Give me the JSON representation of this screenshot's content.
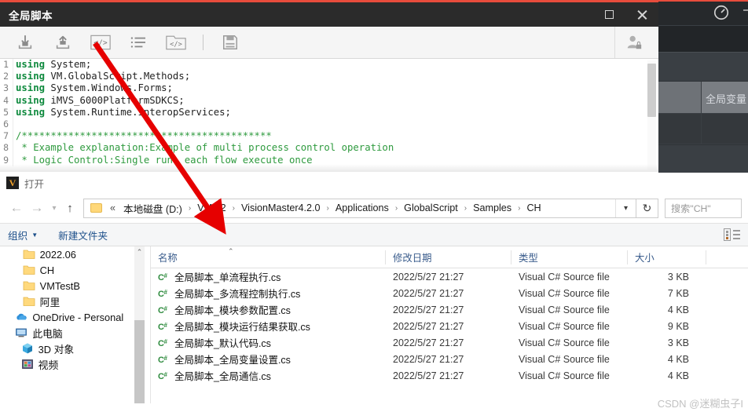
{
  "background_app": {
    "accent_color": "#e74c3c",
    "gauge_icon": "gauge-icon",
    "panel_label": "全局变量"
  },
  "script_window": {
    "title": "全局脚本",
    "window_buttons": {
      "maximize": "maximize-icon",
      "close": "close-icon"
    },
    "toolbar": {
      "items": [
        {
          "name": "import-icon",
          "label": "导入"
        },
        {
          "name": "export-icon",
          "label": "导出"
        },
        {
          "name": "code-snippet-icon",
          "label": "代码片段"
        },
        {
          "name": "list-icon",
          "label": "列表"
        },
        {
          "name": "code-folder-icon",
          "label": "代码文件夹"
        },
        {
          "name": "save-icon",
          "label": "保存"
        }
      ],
      "user_icon": "user-lock-icon"
    },
    "code": {
      "lines": [
        {
          "n": "1",
          "kw": "using",
          "rest": " System;"
        },
        {
          "n": "2",
          "kw": "using",
          "rest": " VM.GlobalScript.Methods;"
        },
        {
          "n": "3",
          "kw": "using",
          "rest": " System.Windows.Forms;"
        },
        {
          "n": "4",
          "kw": "using",
          "rest": " iMVS_6000PlatformSDKCS;"
        },
        {
          "n": "5",
          "kw": "using",
          "rest": " System.Runtime.InteropServices;"
        },
        {
          "n": "6",
          "kw": "",
          "rest": ""
        },
        {
          "n": "7",
          "cm": "/*******************************************"
        },
        {
          "n": "8",
          "cm": " * Example explanation:Example of multi process control operation"
        },
        {
          "n": "9",
          "cm": " * Logic Control:Single run, each flow execute once"
        }
      ]
    }
  },
  "explorer": {
    "caption": "打开",
    "logo_text": "V",
    "nav": {
      "back": "back-arrow-icon",
      "forward": "forward-arrow-icon",
      "recent": "recent-dropdown-icon",
      "up": "up-arrow-icon",
      "refresh": "refresh-icon",
      "address_dropdown": "address-dropdown-icon"
    },
    "breadcrumb": {
      "overflow": "«",
      "items": [
        "本地磁盘 (D:)",
        "VM4.2",
        "VisionMaster4.2.0",
        "Applications",
        "GlobalScript",
        "Samples",
        "CH"
      ],
      "separator": "›"
    },
    "search_placeholder": "搜索\"CH\"",
    "command_bar": {
      "organize": "组织",
      "new_folder": "新建文件夹",
      "view_icon": "view-layout-icon"
    },
    "tree": [
      {
        "label": "2022.06",
        "icon": "folder-icon",
        "indent": 86
      },
      {
        "label": "CH",
        "icon": "folder-icon",
        "indent": 86
      },
      {
        "label": "VMTestB",
        "icon": "folder-icon",
        "indent": 86
      },
      {
        "label": "阿里",
        "icon": "folder-icon",
        "indent": 86
      },
      {
        "label": "OneDrive - Personal",
        "icon": "onedrive-icon",
        "indent": 58
      },
      {
        "label": "此电脑",
        "icon": "this-pc-icon",
        "indent": 58
      },
      {
        "label": "3D 对象",
        "icon": "3d-objects-icon",
        "indent": 80
      },
      {
        "label": "视频",
        "icon": "videos-icon",
        "indent": 80
      }
    ],
    "file_list": {
      "columns": [
        "名称",
        "修改日期",
        "类型",
        "大小"
      ],
      "sort_indicator": "ascending",
      "rows": [
        {
          "name": "全局脚本_单流程执行.cs",
          "date": "2022/5/27 21:27",
          "type": "Visual C# Source file",
          "size": "3 KB",
          "icon": "csharp-file-icon"
        },
        {
          "name": "全局脚本_多流程控制执行.cs",
          "date": "2022/5/27 21:27",
          "type": "Visual C# Source file",
          "size": "7 KB",
          "icon": "csharp-file-icon"
        },
        {
          "name": "全局脚本_模块参数配置.cs",
          "date": "2022/5/27 21:27",
          "type": "Visual C# Source file",
          "size": "4 KB",
          "icon": "csharp-file-icon"
        },
        {
          "name": "全局脚本_模块运行结果获取.cs",
          "date": "2022/5/27 21:27",
          "type": "Visual C# Source file",
          "size": "9 KB",
          "icon": "csharp-file-icon"
        },
        {
          "name": "全局脚本_默认代码.cs",
          "date": "2022/5/27 21:27",
          "type": "Visual C# Source file",
          "size": "3 KB",
          "icon": "csharp-file-icon"
        },
        {
          "name": "全局脚本_全局变量设置.cs",
          "date": "2022/5/27 21:27",
          "type": "Visual C# Source file",
          "size": "4 KB",
          "icon": "csharp-file-icon"
        },
        {
          "name": "全局脚本_全局通信.cs",
          "date": "2022/5/27 21:27",
          "type": "Visual C# Source file",
          "size": "4 KB",
          "icon": "csharp-file-icon"
        }
      ]
    }
  },
  "annotation": {
    "arrow_color": "#e60000"
  },
  "watermark": "CSDN @迷糊虫子I"
}
